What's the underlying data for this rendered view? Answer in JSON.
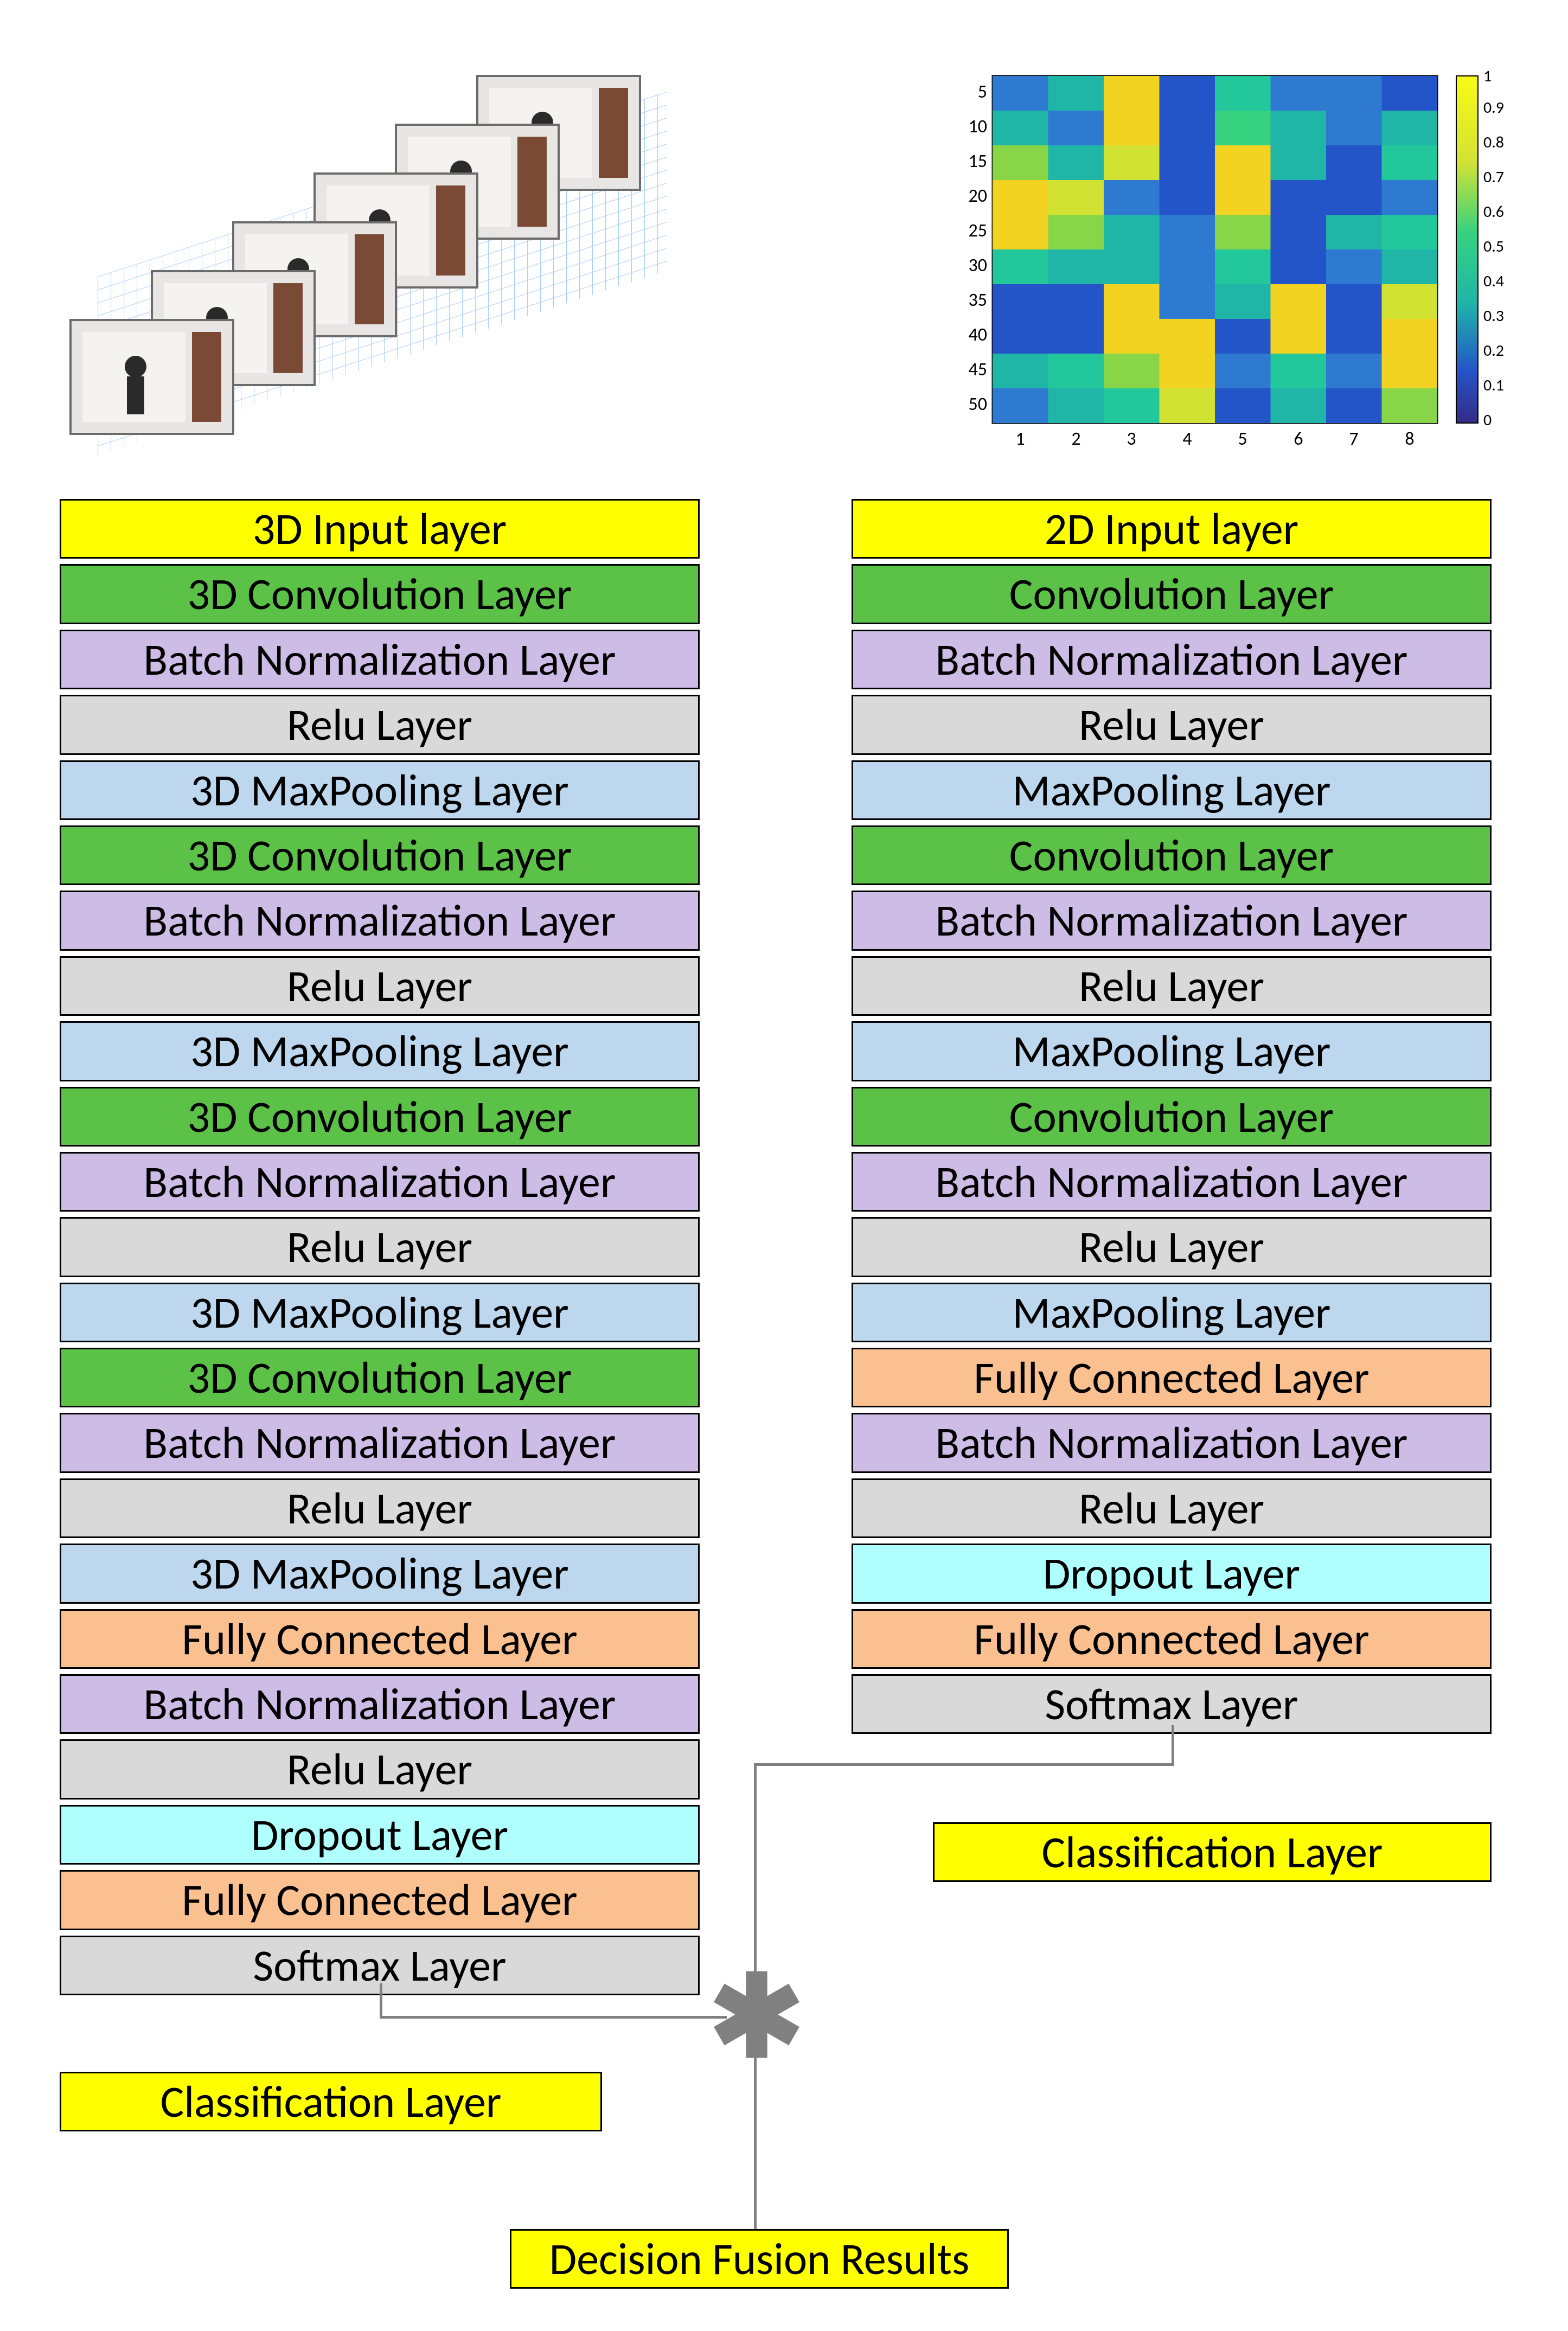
{
  "top": {
    "left_img_alt": "stack of video frames on 3D grid",
    "right_img_alt": "heatmap of features"
  },
  "left_stack": [
    {
      "label": "3D Input layer",
      "color": "c-yellow"
    },
    {
      "label": "3D Convolution Layer",
      "color": "c-green"
    },
    {
      "label": "Batch Normalization Layer",
      "color": "c-lav"
    },
    {
      "label": "Relu Layer",
      "color": "c-grey"
    },
    {
      "label": "3D MaxPooling Layer",
      "color": "c-blue"
    },
    {
      "label": "3D Convolution Layer",
      "color": "c-green"
    },
    {
      "label": "Batch Normalization Layer",
      "color": "c-lav"
    },
    {
      "label": "Relu Layer",
      "color": "c-grey"
    },
    {
      "label": "3D MaxPooling Layer",
      "color": "c-blue"
    },
    {
      "label": "3D Convolution Layer",
      "color": "c-green"
    },
    {
      "label": "Batch Normalization Layer",
      "color": "c-lav"
    },
    {
      "label": "Relu Layer",
      "color": "c-grey"
    },
    {
      "label": "3D MaxPooling Layer",
      "color": "c-blue"
    },
    {
      "label": "3D Convolution Layer",
      "color": "c-green"
    },
    {
      "label": "Batch Normalization Layer",
      "color": "c-lav"
    },
    {
      "label": "Relu Layer",
      "color": "c-grey"
    },
    {
      "label": "3D MaxPooling Layer",
      "color": "c-blue"
    },
    {
      "label": "Fully Connected Layer",
      "color": "c-orange"
    },
    {
      "label": "Batch Normalization Layer",
      "color": "c-lav"
    },
    {
      "label": "Relu Layer",
      "color": "c-grey"
    },
    {
      "label": "Dropout Layer",
      "color": "c-cyan"
    },
    {
      "label": "Fully Connected Layer",
      "color": "c-orange"
    },
    {
      "label": "Softmax Layer",
      "color": "c-grey"
    }
  ],
  "left_class": "Classification Layer",
  "right_stack": [
    {
      "label": "2D Input layer",
      "color": "c-yellow"
    },
    {
      "label": "Convolution Layer",
      "color": "c-green"
    },
    {
      "label": "Batch Normalization Layer",
      "color": "c-lav"
    },
    {
      "label": "Relu Layer",
      "color": "c-grey"
    },
    {
      "label": "MaxPooling Layer",
      "color": "c-blue"
    },
    {
      "label": "Convolution Layer",
      "color": "c-green"
    },
    {
      "label": "Batch Normalization Layer",
      "color": "c-lav"
    },
    {
      "label": "Relu Layer",
      "color": "c-grey"
    },
    {
      "label": "MaxPooling Layer",
      "color": "c-blue"
    },
    {
      "label": "Convolution Layer",
      "color": "c-green"
    },
    {
      "label": "Batch Normalization Layer",
      "color": "c-lav"
    },
    {
      "label": "Relu Layer",
      "color": "c-grey"
    },
    {
      "label": "MaxPooling Layer",
      "color": "c-blue"
    },
    {
      "label": "Fully Connected Layer",
      "color": "c-orange"
    },
    {
      "label": "Batch Normalization Layer",
      "color": "c-lav"
    },
    {
      "label": "Relu Layer",
      "color": "c-grey"
    },
    {
      "label": "Dropout Layer",
      "color": "c-cyan"
    },
    {
      "label": "Fully Connected Layer",
      "color": "c-orange"
    },
    {
      "label": "Softmax Layer",
      "color": "c-grey"
    }
  ],
  "right_class": "Classification Layer",
  "fusion": {
    "label": "Decision Fusion Results"
  },
  "chart_data": {
    "type": "heatmap",
    "title": "",
    "x_ticks": [
      1,
      2,
      3,
      4,
      5,
      6,
      7,
      8
    ],
    "y_ticks": [
      5,
      10,
      15,
      20,
      25,
      30,
      35,
      40,
      45,
      50
    ],
    "colorbar_ticks": [
      0,
      0.1,
      0.2,
      0.3,
      0.4,
      0.5,
      0.6,
      0.7,
      0.8,
      0.9,
      1
    ],
    "value_range": [
      0,
      1
    ],
    "note": "values approximate, read from parula colormap"
  }
}
